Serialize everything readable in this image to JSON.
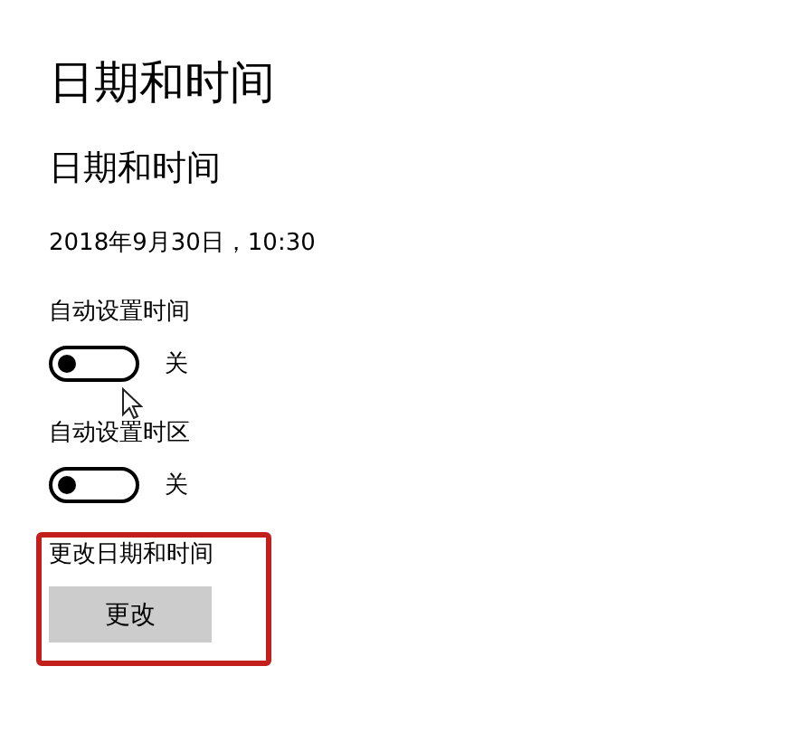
{
  "page_title": "日期和时间",
  "section_title": "日期和时间",
  "current_datetime": "2018年9月30日，10:30",
  "settings": [
    {
      "kind": "toggle",
      "label": "自动设置时间",
      "on": false,
      "state_text": "关"
    },
    {
      "kind": "toggle",
      "label": "自动设置时区",
      "on": false,
      "state_text": "关"
    },
    {
      "kind": "button",
      "label": "更改日期和时间",
      "button_text": "更改",
      "highlighted": true
    }
  ]
}
